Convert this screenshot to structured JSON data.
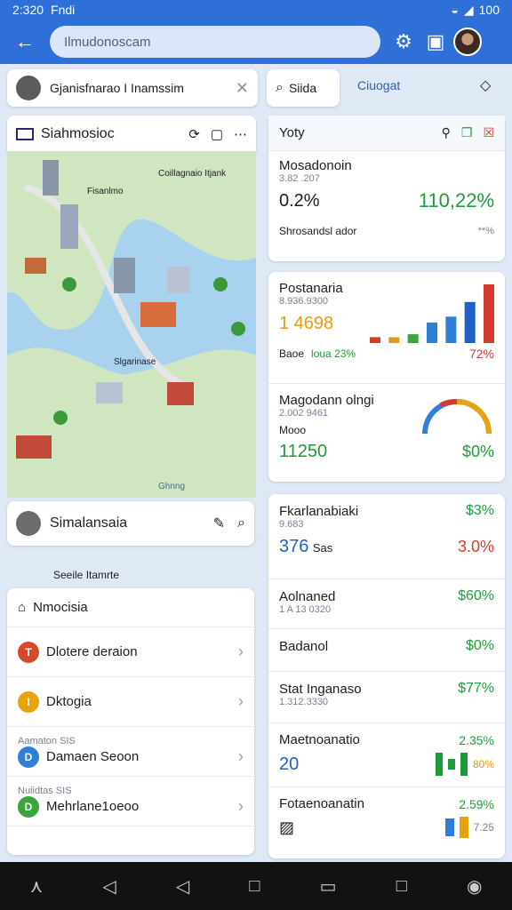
{
  "status": {
    "time": "2:320",
    "label": "Fndi",
    "battery": "100"
  },
  "search": {
    "value": "Ilmudonoscam"
  },
  "top_left": {
    "title": "Gjanisfnarao I Inamssim"
  },
  "top_right": {
    "tab_active": "Siida",
    "tab_other": "Ciuogat"
  },
  "map_panel": {
    "title": "Siahmosioc",
    "labels": [
      "Coillagnaio Itjank",
      "Fisanlmo",
      "Ghnng",
      "Slgarinase"
    ],
    "footer_title": "Simalansaia",
    "footer_sub": "Seeile Itamrte"
  },
  "list": {
    "title": "Nmocisia",
    "items": [
      {
        "label": "Dlotere deraion",
        "icon": "T",
        "color": "#d64a2c"
      },
      {
        "label": "Dktogia",
        "icon": "I",
        "color": "#e7a20c",
        "note": ""
      },
      {
        "label": "Damaen Seoon",
        "icon": "D",
        "color": "#2f7fd8",
        "note": "Aamaton SIS"
      },
      {
        "label": "Mehrlane1oeoo",
        "icon": "D",
        "color": "#3aa53a",
        "note": "Nuiidtas SIS"
      }
    ]
  },
  "right_panel": {
    "header": "Yoty",
    "block1": {
      "title": "Mosadonoin",
      "sub": "3.82 .207",
      "left": "0.2%",
      "right": "110,22%",
      "footer": "Shrosandsl ador",
      "footer_right": "**%"
    },
    "block2": {
      "title": "Postanaria",
      "sub": "8.936.9300",
      "value": "1 4698",
      "footer_left": "Baoe",
      "footer_mid": "loua 23%",
      "footer_right": "72%"
    },
    "block3": {
      "title": "Magodann olngi",
      "sub": "2.002 9461",
      "label": "Mooo",
      "value": "11250",
      "right": "$0%"
    }
  },
  "stats": [
    {
      "title": "Fkarlanabiaki",
      "sub": "9.683",
      "left": "376",
      "left_suffix": "Sas",
      "right_top": "$3%",
      "right_bottom": "3.0%"
    },
    {
      "title": "Aolnaned",
      "sub": "1 A 13 0320",
      "right": "$60%"
    },
    {
      "title": "Badanol",
      "right": "$0%"
    },
    {
      "title": "Stat Inganaso",
      "sub": "1.312.3330",
      "right": "$77%"
    },
    {
      "title": "Maetnoanatio",
      "left": "20",
      "right_top": "2.35%",
      "right_bottom": "80%"
    },
    {
      "title": "Fotaenoanatin",
      "right_top": "2.59%",
      "right_bottom": "7.25"
    }
  ],
  "chart_data": {
    "type": "bar",
    "categories": [
      "1",
      "2",
      "3",
      "4",
      "5",
      "6",
      "7"
    ],
    "values": [
      4,
      4,
      6,
      14,
      18,
      28,
      40
    ],
    "colors": [
      "#d63a2f",
      "#e39b0b",
      "#3aa53a",
      "#2f7fd8",
      "#2f7fd8",
      "#1f5fc8",
      "#d63a2f"
    ],
    "title": "",
    "xlabel": "",
    "ylabel": ""
  }
}
